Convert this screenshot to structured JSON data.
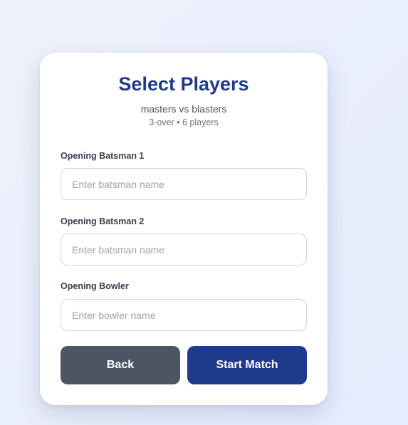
{
  "header": {
    "title": "Select Players",
    "match": "masters vs blasters",
    "format": "3-over • 6 players"
  },
  "fields": {
    "batsman1": {
      "label": "Opening Batsman 1",
      "value": "",
      "placeholder": "Enter batsman name"
    },
    "batsman2": {
      "label": "Opening Batsman 2",
      "value": "",
      "placeholder": "Enter batsman name"
    },
    "bowler": {
      "label": "Opening Bowler",
      "value": "",
      "placeholder": "Enter bowler name"
    }
  },
  "actions": {
    "back_label": "Back",
    "start_label": "Start Match"
  },
  "colors": {
    "primary": "#1e3a8a",
    "secondary": "#4b5563",
    "background": "#e9eefc"
  }
}
